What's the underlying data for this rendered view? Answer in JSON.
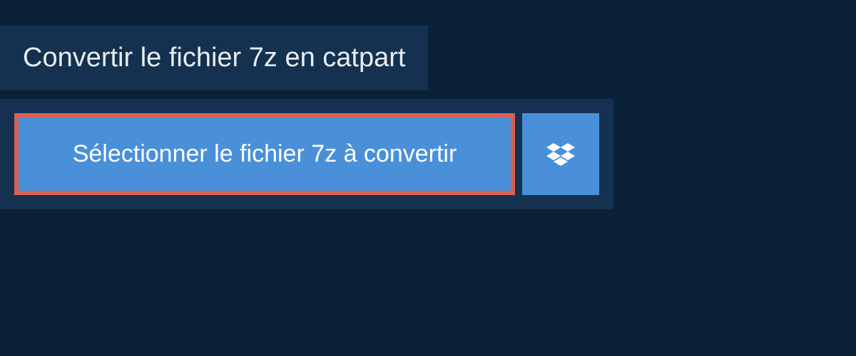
{
  "header": {
    "title": "Convertir le fichier 7z en catpart"
  },
  "actions": {
    "select_label": "Sélectionner le fichier 7z à convertir"
  },
  "colors": {
    "bg_dark": "#0a2138",
    "bg_panel": "#14314f",
    "button_blue": "#4a90d9",
    "highlight_border": "#d96055",
    "text_light": "#e8edf2",
    "text_white": "#ffffff"
  }
}
